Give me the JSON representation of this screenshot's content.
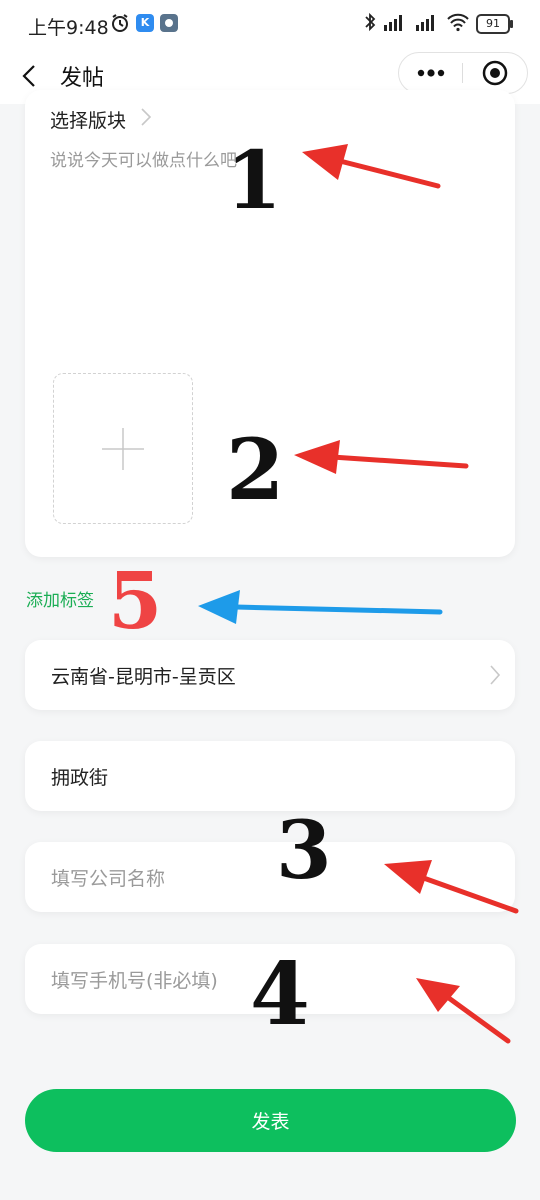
{
  "status_bar": {
    "time": "上午9:48",
    "app_badge": "K",
    "battery": "91"
  },
  "nav": {
    "title": "发帖"
  },
  "editor": {
    "section_label": "选择版块",
    "content_placeholder": "说说今天可以做点什么吧"
  },
  "add_tag_label": "添加标签",
  "form": {
    "region_value": "云南省-昆明市-呈贡区",
    "street_value": "拥政街",
    "company_placeholder": "填写公司名称",
    "phone_placeholder": "填写手机号(非必填)"
  },
  "submit_label": "发表",
  "annotations": {
    "num1": "1",
    "num2": "2",
    "num3": "3",
    "num4": "4",
    "num5": "5"
  },
  "colors": {
    "accent_green": "#0dbf5e",
    "tag_green": "#1aad54",
    "arrow_red": "#e8302a",
    "arrow_blue": "#1e9be9"
  }
}
